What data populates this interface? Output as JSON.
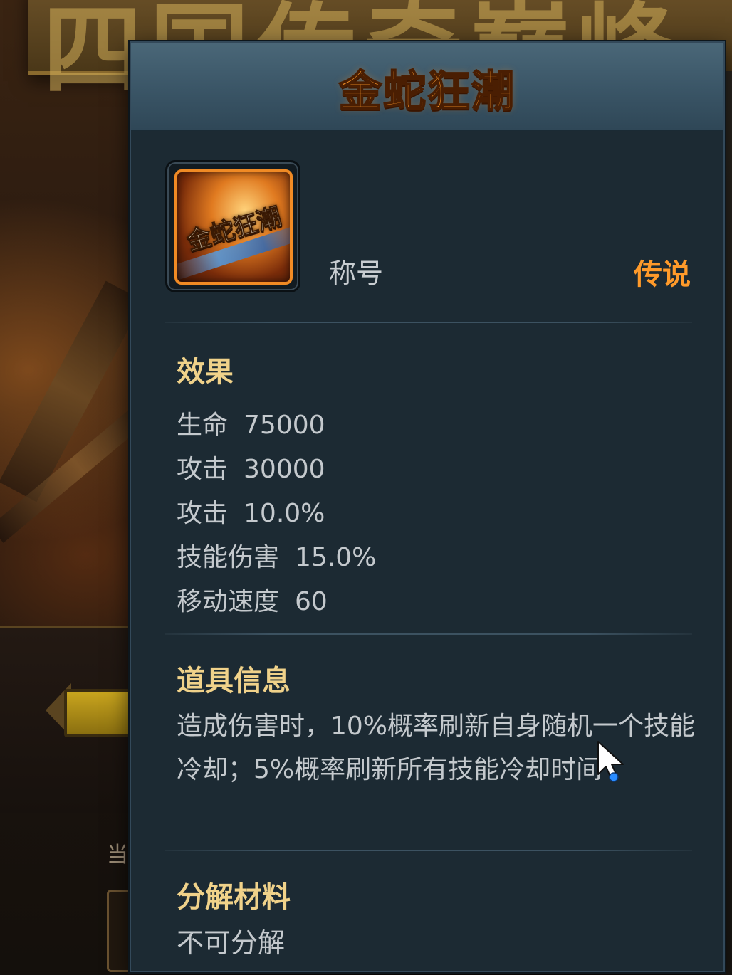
{
  "background": {
    "banner_text": "四国传奇巅峰",
    "caption": "当"
  },
  "tooltip": {
    "title": "金蛇狂潮",
    "icon": {
      "name": "title-badge-icon",
      "art_text": "金蛇狂潮"
    },
    "item_type": "称号",
    "rarity": "传说",
    "colors": {
      "title": "#ff9a2a",
      "rarity": "#ff9a2a",
      "heading": "#f0d28a",
      "body_text": "#c4c9cd",
      "panel_bg": "#1c2a33",
      "header_bg": "#3a5566"
    },
    "effects": {
      "heading": "效果",
      "stats": [
        {
          "label": "生命",
          "value": "75000"
        },
        {
          "label": "攻击",
          "value": "30000"
        },
        {
          "label": "攻击",
          "value": "10.0%"
        },
        {
          "label": "技能伤害",
          "value": "15.0%"
        },
        {
          "label": "移动速度",
          "value": "60"
        }
      ]
    },
    "item_info": {
      "heading": "道具信息",
      "description": "造成伤害时，10%概率刷新自身随机一个技能冷却；5%概率刷新所有技能冷却时间"
    },
    "decompose": {
      "heading": "分解材料",
      "text": "不可分解"
    }
  }
}
